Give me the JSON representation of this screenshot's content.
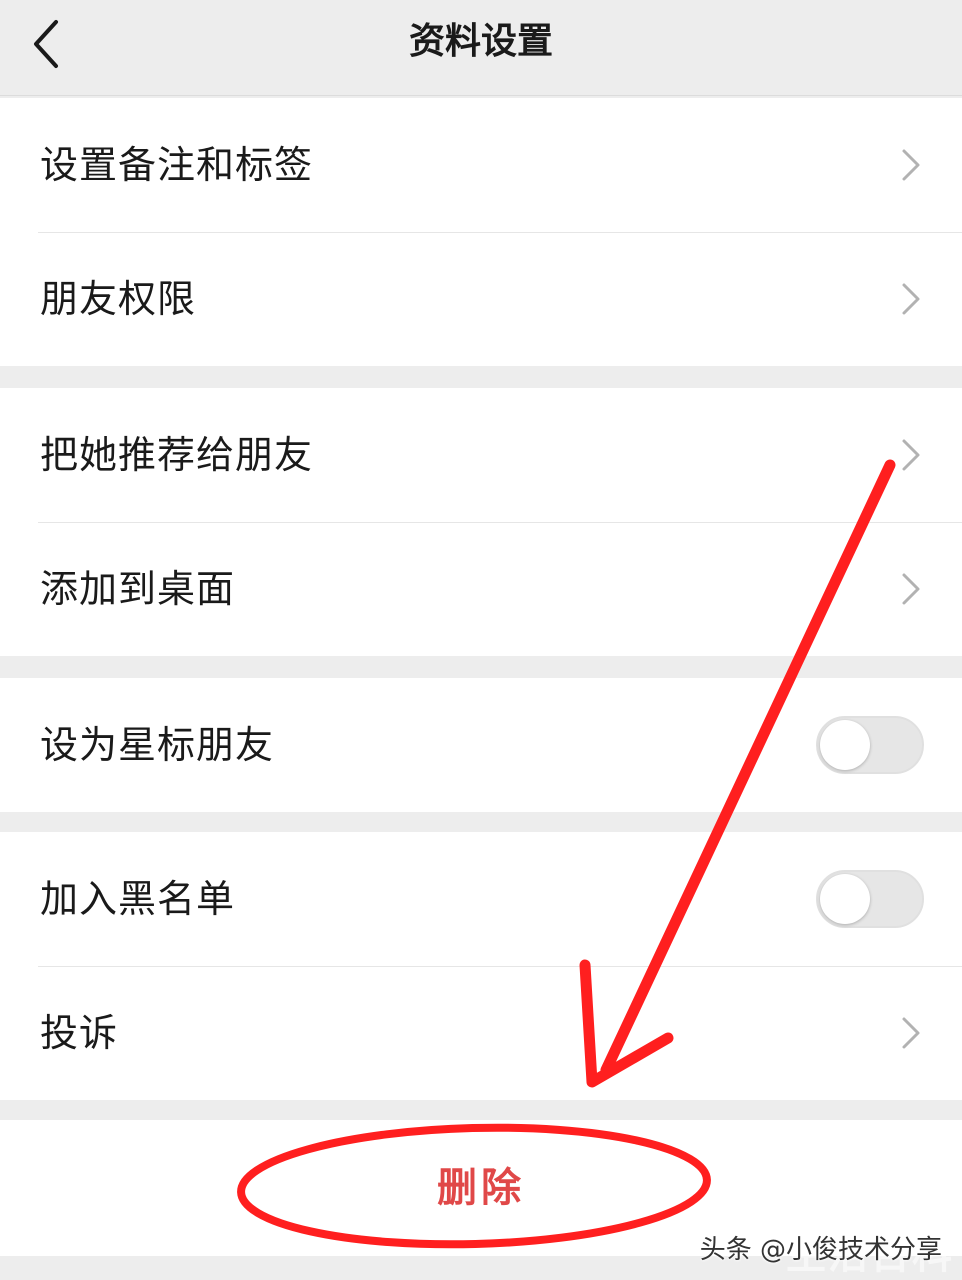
{
  "header": {
    "title": "资料设置",
    "back_icon": "chevron-left-icon"
  },
  "groups": [
    {
      "items": [
        {
          "label": "设置备注和标签",
          "control": "chevron"
        },
        {
          "label": "朋友权限",
          "control": "chevron"
        }
      ]
    },
    {
      "items": [
        {
          "label": "把她推荐给朋友",
          "control": "chevron"
        },
        {
          "label": "添加到桌面",
          "control": "chevron"
        }
      ]
    },
    {
      "items": [
        {
          "label": "设为星标朋友",
          "control": "toggle",
          "on": false
        }
      ]
    },
    {
      "items": [
        {
          "label": "加入黑名单",
          "control": "toggle",
          "on": false
        },
        {
          "label": "投诉",
          "control": "chevron"
        }
      ]
    }
  ],
  "delete": {
    "label": "删除",
    "color": "#e04848"
  },
  "annotation": {
    "arrow_color": "#ff1f1f",
    "ellipse_color": "#ff1f1f"
  },
  "watermark": {
    "text": "头条 @小俊技术分享",
    "logo": "生活百科"
  },
  "colors": {
    "background": "#ededed",
    "row_background": "#ffffff",
    "text": "#1a1a1a",
    "chevron": "#b2b2b2",
    "toggle_off": "#e6e6e6"
  }
}
